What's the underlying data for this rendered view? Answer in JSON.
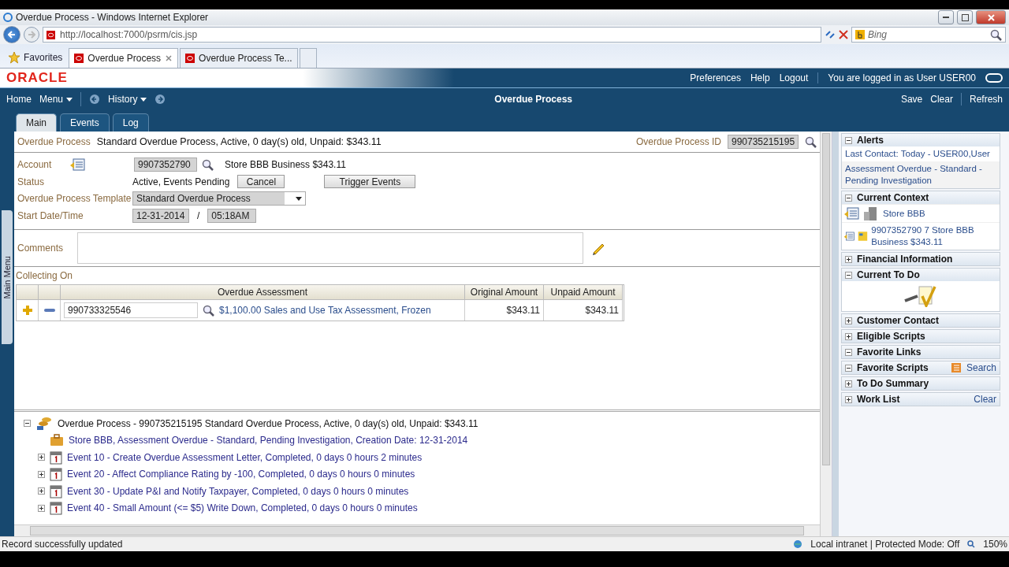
{
  "browser": {
    "title": "Overdue Process - Windows Internet Explorer",
    "url": "http://localhost:7000/psrm/cis.jsp",
    "search_placeholder": "Bing",
    "favorites": "Favorites",
    "tabs": [
      {
        "label": "Overdue Process",
        "selected": true
      },
      {
        "label": "Overdue Process Te...",
        "selected": false
      }
    ]
  },
  "app": {
    "logo": "ORACLE",
    "header_links": [
      "Preferences",
      "Help",
      "Logout"
    ],
    "login": "You are logged in as User USER00",
    "nav": [
      {
        "label": "Home",
        "kind": "link"
      },
      {
        "label": "Menu",
        "kind": "menu"
      },
      {
        "label": "History",
        "kind": "history"
      }
    ],
    "page_title": "Overdue Process",
    "actions": [
      "Save",
      "Clear",
      "Refresh"
    ]
  },
  "tabs": [
    {
      "label": "Main",
      "selected": true
    },
    {
      "label": "Events",
      "selected": false
    },
    {
      "label": "Log",
      "selected": false
    }
  ],
  "main_menu": "Main Menu",
  "header": {
    "label": "Overdue Process",
    "value": "Standard Overdue Process, Active, 0 day(s) old, Unpaid: $343.11",
    "id_label": "Overdue Process ID",
    "id_value": "990735215195"
  },
  "form": {
    "account": {
      "label": "Account",
      "value": "9907352790",
      "description": "Store BBB Business $343.11"
    },
    "status": {
      "label": "Status",
      "value": "Active, Events Pending",
      "buttons": [
        "Cancel",
        "Trigger Events"
      ]
    },
    "template": {
      "label": "Overdue Process Template",
      "value": "Standard Overdue Process"
    },
    "start": {
      "label": "Start Date/Time",
      "date": "12-31-2014",
      "separator": "/",
      "time": "05:18AM"
    },
    "comments": {
      "label": "Comments"
    }
  },
  "collecting": {
    "title": "Collecting On",
    "columns": [
      "Overdue Assessment",
      "Original Amount",
      "Unpaid Amount"
    ],
    "rows": [
      {
        "id": "990733325546",
        "description": "$1,100.00 Sales and Use Tax Assessment, Frozen",
        "original": "$343.11",
        "unpaid": "$343.11"
      }
    ]
  },
  "tree": {
    "text": "Overdue Process - 990735215195 Standard Overdue Process, Active, 0 day(s) old, Unpaid: $343.11",
    "expanded": true,
    "children": [
      {
        "kind": "alert",
        "text": "Store BBB, Assessment Overdue - Standard, Pending Investigation, Creation Date: 12-31-2014"
      },
      {
        "kind": "event",
        "expanded": false,
        "text": "Event 10 - Create Overdue Assessment Letter, Completed, 0 days 0 hours 2 minutes"
      },
      {
        "kind": "event",
        "expanded": false,
        "text": "Event 20 - Affect Compliance Rating by -100, Completed, 0 days 0 hours 0 minutes"
      },
      {
        "kind": "event",
        "expanded": false,
        "text": "Event 30 - Update P&I and Notify Taxpayer, Completed, 0 days 0 hours 0 minutes"
      },
      {
        "kind": "event",
        "expanded": false,
        "text": "Event 40 - Small Amount (<= $5) Write Down, Completed, 0 days 0 hours 0 minutes"
      }
    ]
  },
  "dashboard": [
    {
      "title": "Alerts",
      "expanded": true,
      "kind": "list",
      "items": [
        "Last Contact: Today - USER00,User",
        "Assessment Overdue - Standard - Pending Investigation"
      ]
    },
    {
      "title": "Current Context",
      "expanded": true,
      "kind": "context",
      "items": [
        {
          "kind": "person",
          "text": "Store BBB"
        },
        {
          "kind": "account",
          "text": "9907352790 7 Store BBB Business $343.11"
        }
      ]
    },
    {
      "title": "Financial Information",
      "expanded": false
    },
    {
      "title": "Current To Do",
      "expanded": true,
      "kind": "todo"
    },
    {
      "title": "Customer Contact",
      "expanded": false
    },
    {
      "title": "Eligible Scripts",
      "expanded": false
    },
    {
      "title": "Favorite Links",
      "expanded": true
    },
    {
      "title": "Favorite Scripts",
      "expanded": true,
      "action": "Search"
    },
    {
      "title": "To Do Summary",
      "expanded": false
    },
    {
      "title": "Work List",
      "expanded": false,
      "action": "Clear"
    }
  ],
  "status_bar": {
    "message": "Record successfully updated",
    "zone": "Local intranet | Protected Mode: Off",
    "zoom": "150%"
  }
}
